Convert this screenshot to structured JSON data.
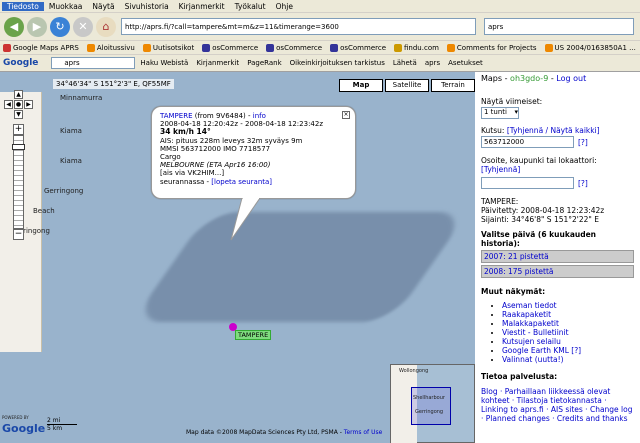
{
  "menubar": [
    "Tiedosto",
    "Muokkaa",
    "Näytä",
    "Sivuhistoria",
    "Kirjanmerkit",
    "Työkalut",
    "Ohje"
  ],
  "url": "http://aprs.fi/?call=tampere&mt=m&z=11&timerange=3600",
  "search": {
    "value": "aprs"
  },
  "bookmarks": [
    "Google Maps APRS",
    "Aloitussivu",
    "Uutisotsikot",
    "osCommerce",
    "osCommerce",
    "osCommerce",
    "findu.com",
    "Comments for Projects",
    "US 2004/0163850A1 ..."
  ],
  "google_toolbar": {
    "input": "aprs",
    "search_label": "Haku Webistä",
    "bookmarks": "Kirjanmerkit",
    "pagerank": "PageRank",
    "spellcheck": "Oikeinkirjoituksen tarkistus",
    "send": "Lähetä",
    "aprs": "aprs",
    "settings": "Asetukset"
  },
  "map": {
    "coords": "34°46'34\" S 151°2'3\" E, QF55MF",
    "types": [
      "Map",
      "Satellite",
      "Terrain"
    ],
    "places": [
      "Minnamurra",
      "Kiama",
      "Kiama",
      "Gerringong",
      "Beach",
      "erringong",
      "Wollongong",
      "Shellharbour",
      "Gerringong"
    ],
    "scale": [
      "2 mi",
      "5 km"
    ],
    "copyright": "Map data ©2008 MapData Sciences Pty Ltd, PSMA",
    "terms": "Terms of Use",
    "powered": "POWERED BY",
    "marker_label": "TAMPERE"
  },
  "bubble": {
    "name": "TAMPERE",
    "from": "(from 9V6484)",
    "info": "info",
    "time": "2008-04-18 12:20:42z - 2008-04-18 12:23:42z",
    "speed": "34 km/h 14°",
    "ais": "AIS: pituus 228m leveys 32m syväys 9m",
    "mmsi": "MMSI 563712000 IMO 7718577",
    "type": "Cargo",
    "dest": "MELBOURNE (ETA Apr16 16:00)",
    "via": "[ais via VK2HIM...]",
    "track": "seurannassa",
    "stop": "[lopeta seuranta]"
  },
  "sidebar": {
    "maps": "Maps",
    "user": "oh3gdo-9",
    "logout": "Log out",
    "show_label": "Näytä viimeiset:",
    "show_value": "1 tunti",
    "call_label": "Kutsu:",
    "call_clear": "[Tyhjennä / Näytä kaikki]",
    "call_value": "563712000",
    "help": "[?]",
    "addr_label": "Osoite, kaupunki tai lokaattori:",
    "addr_clear": "[Tyhjennä]",
    "station": "TAMPERE:",
    "updated": "Päivitetty: 2008-04-18 12:23:42z",
    "location": "Sijainti: 34°46'8\" S 151°2'22\" E",
    "choose_day": "Valitse päivä (6 kuukauden historia):",
    "days": [
      "2007: 21 pistettä",
      "2008: 175 pistettä"
    ],
    "other_views": "Muut näkymät:",
    "views": [
      "Aseman tiedot",
      "Raakapaketit",
      "Malakkapaketit",
      "Viestit - Bulletiinit",
      "Kutsujen selailu",
      "Google Earth KML [?]",
      "Valinnat (uutta!)"
    ],
    "about": "Tietoa palvelusta:",
    "about_links": "Blog · Parhaillaan liikkeessä olevat kohteet · Tilastoja tietokannasta · Linking to aprs.fi · AIS sites · Change log · Planned changes · Credits and thanks"
  }
}
